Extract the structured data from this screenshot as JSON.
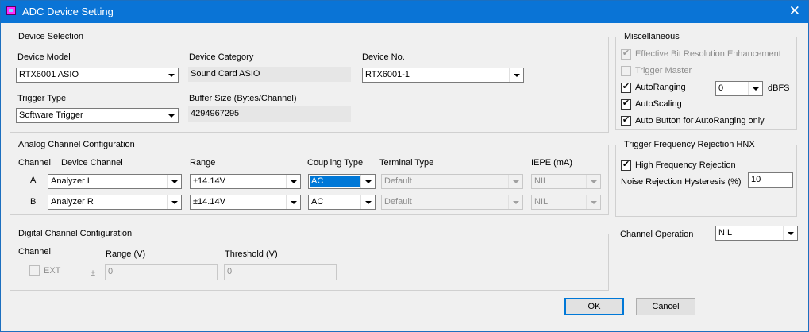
{
  "window": {
    "title": "ADC Device Setting",
    "close_glyph": "✕"
  },
  "device_selection": {
    "legend": "Device Selection",
    "device_model_label": "Device Model",
    "device_model_value": "RTX6001 ASIO",
    "device_category_label": "Device Category",
    "device_category_value": "Sound Card ASIO",
    "device_no_label": "Device No.",
    "device_no_value": "RTX6001-1",
    "trigger_type_label": "Trigger Type",
    "trigger_type_value": "Software Trigger",
    "buffer_size_label": "Buffer Size (Bytes/Channel)",
    "buffer_size_value": "4294967295"
  },
  "miscellaneous": {
    "legend": "Miscellaneous",
    "ebre_label": "Effective Bit Resolution Enhancement",
    "ebre_checked": true,
    "trigger_master_label": "Trigger Master",
    "trigger_master_checked": false,
    "autoranging_label": "AutoRanging",
    "autoranging_checked": true,
    "autoranging_value": "0",
    "dbfs_label": "dBFS",
    "autoscaling_label": "AutoScaling",
    "autoscaling_checked": true,
    "auto_button_label": "Auto Button for AutoRanging only",
    "auto_button_checked": true,
    "check_glyph": "✔"
  },
  "analog": {
    "legend": "Analog Channel Configuration",
    "headers": {
      "channel": "Channel",
      "device_channel": "Device Channel",
      "range": "Range",
      "coupling": "Coupling Type",
      "terminal": "Terminal Type",
      "iepe": "IEPE (mA)"
    },
    "rows": [
      {
        "channel": "A",
        "device_channel": "Analyzer L",
        "range": "±14.14V",
        "coupling": "AC",
        "terminal": "Default",
        "iepe": "NIL"
      },
      {
        "channel": "B",
        "device_channel": "Analyzer R",
        "range": "±14.14V",
        "coupling": "AC",
        "terminal": "Default",
        "iepe": "NIL"
      }
    ]
  },
  "rejection": {
    "legend": "Trigger Frequency Rejection HNX",
    "hf_label": "High Frequency Rejection",
    "hf_checked": true,
    "hysteresis_label": "Noise Rejection Hysteresis (%)",
    "hysteresis_value": "10"
  },
  "channel_operation": {
    "label": "Channel Operation",
    "value": "NIL"
  },
  "digital": {
    "legend": "Digital Channel Configuration",
    "channel_label": "Channel",
    "ext_label": "EXT",
    "ext_checked": false,
    "pm_label": "±",
    "range_label": "Range (V)",
    "range_value": "0",
    "threshold_label": "Threshold (V)",
    "threshold_value": "0"
  },
  "buttons": {
    "ok": "OK",
    "cancel": "Cancel"
  }
}
